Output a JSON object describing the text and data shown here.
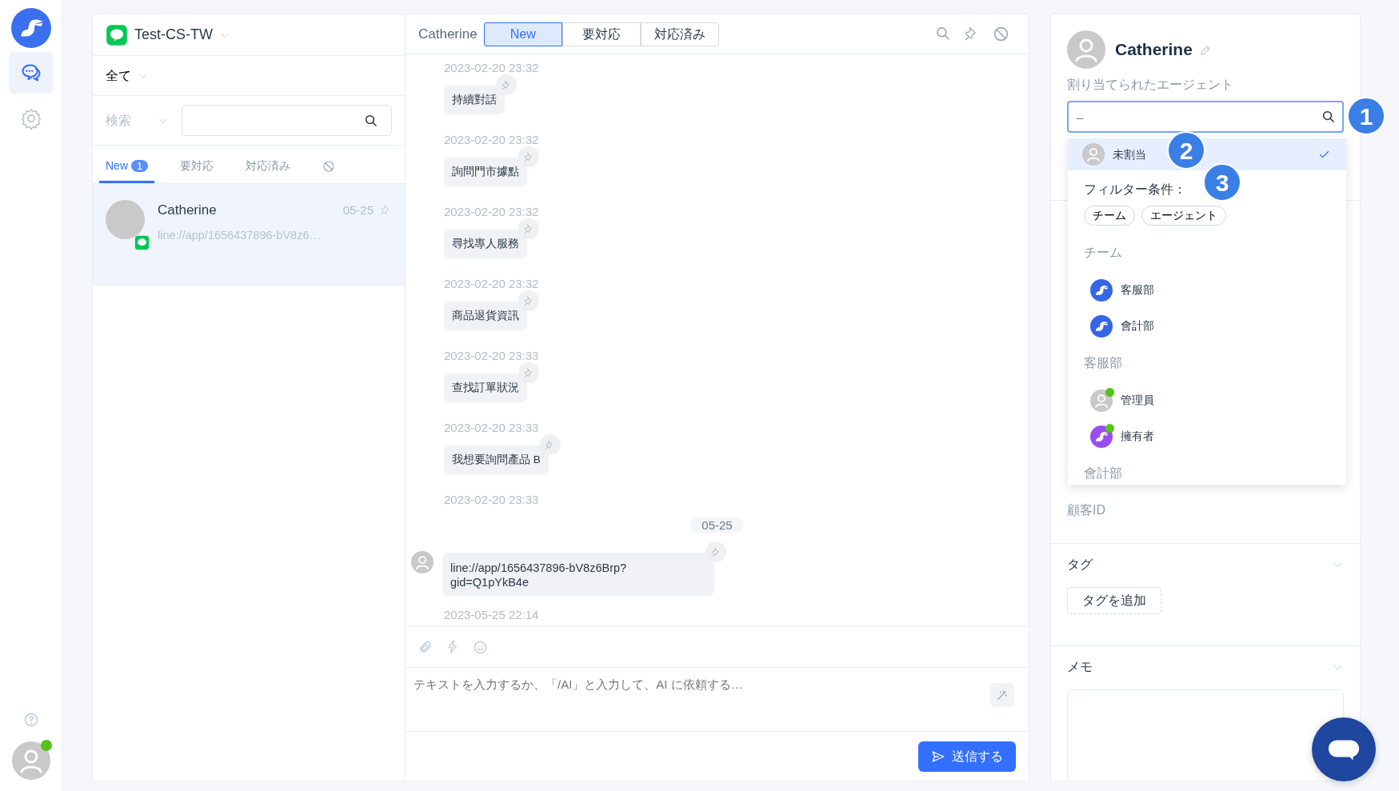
{
  "rail": {
    "items": [
      {
        "kind": "chat",
        "selected": true
      },
      {
        "kind": "settings",
        "selected": false
      }
    ],
    "user_online": true
  },
  "inbox": {
    "channel": "Test-CS-TW",
    "filter": "全て",
    "search_label": "検索",
    "tabs": [
      {
        "kind": "text",
        "label": "New",
        "badge": "1",
        "selected": true
      },
      {
        "kind": "text",
        "label": "要対応",
        "selected": false
      },
      {
        "kind": "text",
        "label": "対応済み",
        "selected": false
      },
      {
        "kind": "blocked",
        "selected": false
      }
    ],
    "conversations": [
      {
        "name": "Catherine",
        "date": "05-25",
        "preview": "line://app/1656437896-bV8z6…",
        "selected": true
      }
    ]
  },
  "chat": {
    "title": "Catherine",
    "tabs": [
      {
        "label": "New",
        "selected": true
      },
      {
        "label": "要対応",
        "selected": false
      },
      {
        "label": "対応済み",
        "selected": false
      }
    ],
    "feed": [
      {
        "kind": "time",
        "text": "2023-02-20 23:32"
      },
      {
        "kind": "bubble",
        "text": "持續對話"
      },
      {
        "kind": "time",
        "text": "2023-02-20 23:32"
      },
      {
        "kind": "bubble",
        "text": "詢問門市據點"
      },
      {
        "kind": "time",
        "text": "2023-02-20 23:32"
      },
      {
        "kind": "bubble",
        "text": "尋找專人服務"
      },
      {
        "kind": "time",
        "text": "2023-02-20 23:32"
      },
      {
        "kind": "bubble",
        "text": "商品退貨資訊"
      },
      {
        "kind": "time",
        "text": "2023-02-20 23:33"
      },
      {
        "kind": "bubble",
        "text": "查找訂單狀況"
      },
      {
        "kind": "time",
        "text": "2023-02-20 23:33"
      },
      {
        "kind": "bubble",
        "text": "我想要詢問產品 B"
      },
      {
        "kind": "time",
        "text": "2023-02-20 23:33"
      },
      {
        "kind": "date",
        "text": "05-25"
      },
      {
        "kind": "customer",
        "text": "line://app/1656437896-bV8z6Brp?\ngid=Q1pYkB4e"
      },
      {
        "kind": "time",
        "text": "2023-05-25 22:14"
      }
    ],
    "composer": {
      "placeholder": "テキストを入力するか、「/AI」と入力して、AI に依頼する…"
    },
    "send": "送信する"
  },
  "profile": {
    "name": "Catherine",
    "assigned_label": "割り当てられたエージェント",
    "agent_search": {
      "placeholder": "–"
    },
    "dropdown": {
      "current": {
        "kind": "person",
        "label": "未割当",
        "selected": true
      },
      "filter_label": "フィルター条件：",
      "chips": [
        "チーム",
        "エージェント"
      ],
      "groups": [
        {
          "heading": "チーム",
          "options": [
            {
              "kind": "team",
              "label": "客服部",
              "online": false,
              "selected": false
            },
            {
              "kind": "team",
              "label": "會計部",
              "online": false,
              "selected": false
            }
          ]
        },
        {
          "heading": "客服部",
          "options": [
            {
              "kind": "person",
              "label": "管理員",
              "online": true,
              "selected": false
            },
            {
              "kind": "member",
              "label": "擁有者",
              "online": true,
              "selected": false
            }
          ]
        },
        {
          "heading": "會計部"
        }
      ]
    },
    "customer_id_label": "顧客ID",
    "sections": [
      {
        "title": "タグ",
        "action": "タグを追加"
      },
      {
        "title": "メモ",
        "kind": "memo"
      }
    ]
  },
  "callouts": [
    "1",
    "2",
    "3"
  ]
}
